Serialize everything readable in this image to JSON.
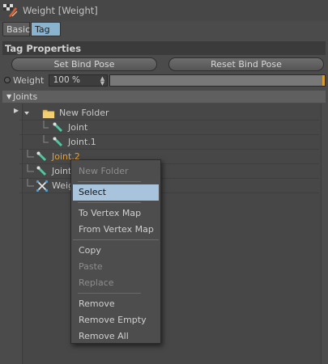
{
  "window": {
    "title": "Weight [Weight]"
  },
  "tabs": [
    {
      "label": "Basic",
      "active": false
    },
    {
      "label": "Tag",
      "active": true
    }
  ],
  "section": {
    "title": "Tag Properties"
  },
  "buttons": {
    "set_bind_pose": "Set Bind Pose",
    "reset_bind_pose": "Reset Bind Pose"
  },
  "weight": {
    "label": "Weight",
    "value": "100 %",
    "slider_fraction": 1.0
  },
  "joints": {
    "header": "Joints",
    "rows": [
      {
        "label": "New Folder",
        "icon": "folder-icon"
      },
      {
        "label": "Joint",
        "icon": "joint-icon"
      },
      {
        "label": "Joint.1",
        "icon": "joint-icon"
      },
      {
        "label": "Joint.2",
        "icon": "joint-icon",
        "highlight": true
      },
      {
        "label": "Joint",
        "icon": "joint-icon"
      },
      {
        "label": "Weight",
        "icon": "weight-tag-icon"
      }
    ]
  },
  "context_menu": {
    "items": [
      {
        "label": "New Folder",
        "enabled": false
      },
      {
        "label": "Select",
        "enabled": true,
        "selected": true
      },
      {
        "label": "To Vertex Map",
        "enabled": true
      },
      {
        "label": "From Vertex Map",
        "enabled": true
      },
      {
        "label": "Copy",
        "enabled": true
      },
      {
        "label": "Paste",
        "enabled": false
      },
      {
        "label": "Replace",
        "enabled": false
      },
      {
        "label": "Remove",
        "enabled": true
      },
      {
        "label": "Remove Empty",
        "enabled": true
      },
      {
        "label": "Remove All",
        "enabled": true
      }
    ]
  },
  "colors": {
    "accent_selected": "#a8c4dc",
    "highlight_text": "#e0a040",
    "slider_marker": "#d99b2a"
  }
}
